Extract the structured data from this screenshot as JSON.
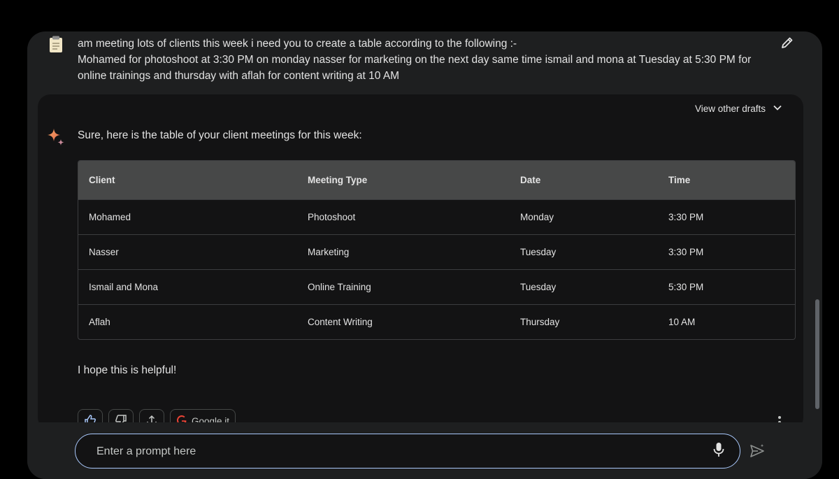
{
  "user_prompt": {
    "text": "am meeting lots of clients this week i need you to create a table according to the following :-\nMohamed for photoshoot at 3:30 PM on monday nasser for marketing  on the next day same time ismail and mona at Tuesday at 5:30 PM for online trainings  and thursday with aflah for content writing at 10 AM"
  },
  "response": {
    "view_drafts_label": "View other drafts",
    "intro": "Sure, here is the table of your client meetings for this week:",
    "table": {
      "headers": [
        "Client",
        "Meeting Type",
        "Date",
        "Time"
      ],
      "rows": [
        [
          "Mohamed",
          "Photoshoot",
          "Monday",
          "3:30 PM"
        ],
        [
          "Nasser",
          "Marketing",
          "Tuesday",
          "3:30 PM"
        ],
        [
          "Ismail and Mona",
          "Online Training",
          "Tuesday",
          "5:30 PM"
        ],
        [
          "Aflah",
          "Content Writing",
          "Thursday",
          "10 AM"
        ]
      ]
    },
    "closing": "I hope this is helpful!",
    "actions": {
      "google_it_label": "Google it"
    }
  },
  "composer": {
    "placeholder": "Enter a prompt here"
  },
  "colors": {
    "page_bg": "#000000",
    "panel_bg": "#1e1f20",
    "card_bg": "#131314",
    "table_header_bg": "#474848",
    "input_border": "#a8c7fa"
  },
  "icons": [
    "clipboard-icon",
    "pencil-icon",
    "chevron-down-icon",
    "sparkle-icon",
    "thumbs-up-icon",
    "thumbs-down-icon",
    "share-icon",
    "google-icon",
    "more-vert-icon",
    "mic-icon",
    "send-icon"
  ]
}
